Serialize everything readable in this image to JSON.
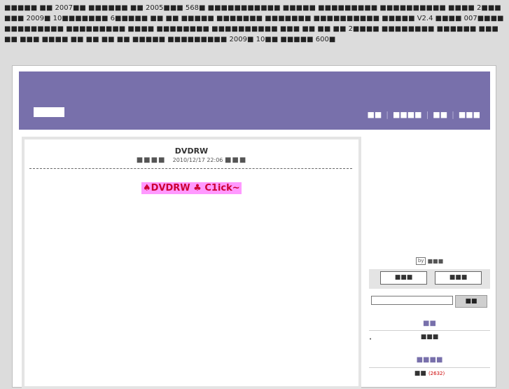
{
  "notice": "■■■■■ ■■ 2007■■ ■■■■■■ ■■ 2005■■■ 568■ ■■■■■■■■■■■ ■■■■■ ■■■■■■■■■ ■■■■■■■■■■ ■■■■ 2■■■■■■ 2009■ 10■■■■■■■ 6■■■■■ ■■ ■■ ■■■■■ ■■■■■■■ ■■■■■■■ ■■■■■■■■■■ ■■■■■ V2.4 ■■■■ 007■■■■■■■■■■■■■ ■■■■■■■■■ ■■■■ ■■■■■■■■ ■■■■■■■■■■ ■■■ ■■ ■■ ■■ 2■■■■ ■■■■■■■■ ■■■■■■ ■■■■■ ■■■ ■■■■ ■■ ■■ ■■ ■■ ■■■■■ ■■■■■■■■■ 2009■ 10■■ ■■■■■ 600■",
  "header": {
    "nav": [
      "■■",
      "■■■■",
      "■■",
      "■■■"
    ]
  },
  "post": {
    "title": "DVDRW",
    "meta_prefix": "■■■■",
    "timestamp": "2010/12/17 22:06",
    "meta_suffix": "■■■",
    "promo_text": "♠DVDRW ♣ C1ick~"
  },
  "sidebar": {
    "by_badge": "by",
    "by_text": "■■■",
    "btn_left": "■■■",
    "btn_right": "■■■",
    "search_placeholder": "",
    "search_button": "■■",
    "section1_title": "■■",
    "section1_item": "■■■",
    "section2_title": "■■■■",
    "section2_item": "■■",
    "section2_count": "(2632)"
  }
}
